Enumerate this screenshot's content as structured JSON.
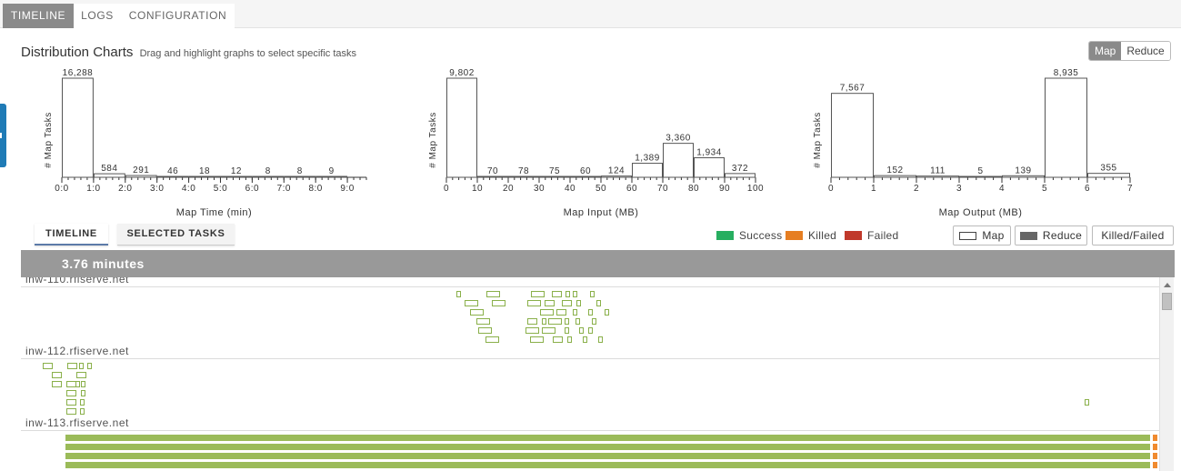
{
  "tabs": [
    {
      "label": "TIMELINE",
      "active": true
    },
    {
      "label": "LOGS",
      "active": false
    },
    {
      "label": "CONFIGURATION",
      "active": false
    }
  ],
  "distribution": {
    "title": "Distribution Charts",
    "subtitle": "Drag and highlight graphs to select specific tasks",
    "toggle": {
      "map": "Map",
      "reduce": "Reduce",
      "selected": "Map"
    }
  },
  "chart_data": [
    {
      "type": "bar",
      "xlabel": "Map Time (min)",
      "ylabel": "# Map Tasks",
      "x_ticks": [
        "0:0",
        "1:0",
        "2:0",
        "3:0",
        "4:0",
        "5:0",
        "6:0",
        "7:0",
        "8:0",
        "9:0"
      ],
      "bins": [
        [
          0,
          1
        ],
        [
          1,
          2
        ],
        [
          2,
          3
        ],
        [
          3,
          4
        ],
        [
          4,
          5
        ],
        [
          5,
          6
        ],
        [
          6,
          7
        ],
        [
          7,
          8
        ],
        [
          8,
          9
        ]
      ],
      "values": [
        16288,
        584,
        291,
        46,
        18,
        12,
        8,
        8,
        9
      ],
      "labels": [
        "16,288",
        "584",
        "291",
        "46",
        "18",
        "12",
        "8",
        "8",
        "9"
      ],
      "xlim": [
        0,
        9.6
      ],
      "grid": false
    },
    {
      "type": "bar",
      "xlabel": "Map Input (MB)",
      "ylabel": "# Map Tasks",
      "x_ticks": [
        "0",
        "10",
        "20",
        "30",
        "40",
        "50",
        "60",
        "70",
        "80",
        "90",
        "100"
      ],
      "bins": [
        [
          0,
          10
        ],
        [
          10,
          20
        ],
        [
          20,
          30
        ],
        [
          30,
          40
        ],
        [
          40,
          50
        ],
        [
          50,
          60
        ],
        [
          60,
          70
        ],
        [
          70,
          80
        ],
        [
          80,
          90
        ],
        [
          90,
          100
        ]
      ],
      "values": [
        9802,
        70,
        78,
        75,
        60,
        124,
        1389,
        3360,
        1934,
        372
      ],
      "labels": [
        "9,802",
        "70",
        "78",
        "75",
        "60",
        "124",
        "1,389",
        "3,360",
        "1,934",
        "372"
      ],
      "xlim": [
        0,
        100
      ],
      "grid": false
    },
    {
      "type": "bar",
      "xlabel": "Map Output (MB)",
      "ylabel": "# Map Tasks",
      "x_ticks": [
        "0",
        "1",
        "2",
        "3",
        "4",
        "5",
        "6",
        "7"
      ],
      "bins": [
        [
          0,
          1
        ],
        [
          1,
          2
        ],
        [
          2,
          3
        ],
        [
          3,
          4
        ],
        [
          4,
          5
        ],
        [
          5,
          6
        ],
        [
          6,
          7
        ]
      ],
      "values": [
        7567,
        152,
        111,
        5,
        139,
        8935,
        355
      ],
      "labels": [
        "7,567",
        "152",
        "111",
        "5",
        "139",
        "8,935",
        "355"
      ],
      "xlim": [
        0,
        7
      ],
      "grid": false
    }
  ],
  "lower": {
    "subtabs": [
      {
        "label": "TIMELINE",
        "active": true
      },
      {
        "label": "SELECTED TASKS",
        "active": false
      }
    ],
    "legend": [
      {
        "label": "Success",
        "color": "#27ae60"
      },
      {
        "label": "Killed",
        "color": "#e67e22"
      },
      {
        "label": "Failed",
        "color": "#c0392b"
      }
    ],
    "type_buttons": [
      {
        "label": "Map",
        "swatch": "#ffffff"
      },
      {
        "label": "Reduce",
        "swatch": "#666666"
      },
      {
        "label": "Killed/Failed",
        "swatch": null
      }
    ],
    "duration": "3.76 minutes",
    "hosts": [
      "inw-110.rfiserve.net",
      "inw-112.rfiserve.net",
      "inw-113.rfiserve.net"
    ],
    "colors": {
      "task_border": "#8ab04a",
      "success_bar": "#9bbb59",
      "killed_bar": "#f08a2e"
    }
  }
}
